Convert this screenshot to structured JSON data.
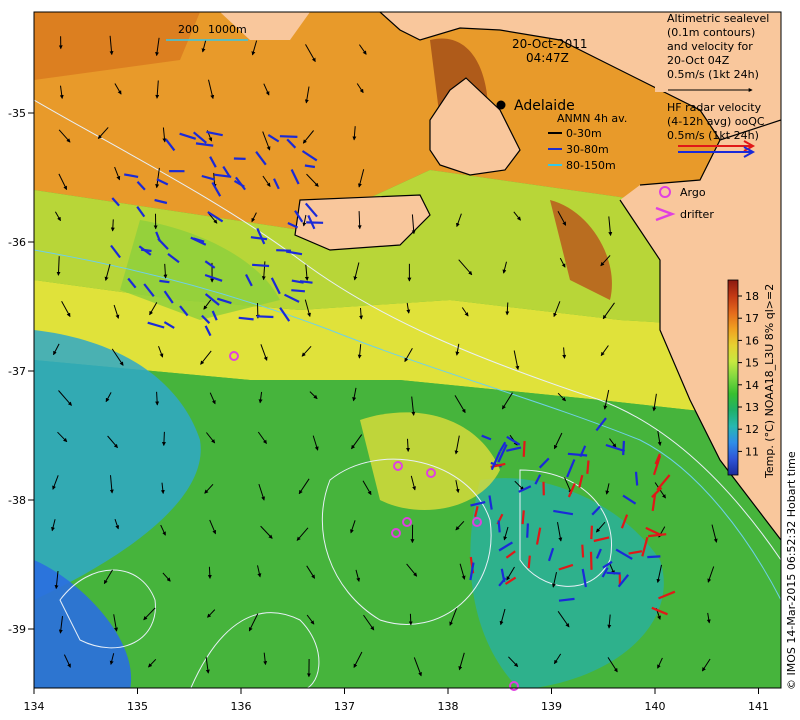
{
  "map": {
    "date": "20-Oct-2011",
    "time": "04:47Z",
    "city": "Adelaide",
    "scale_label": "200",
    "depth_label": "1000m",
    "x_ticks": [
      "134",
      "135",
      "136",
      "137",
      "138",
      "139",
      "140",
      "141"
    ],
    "y_ticks": [
      "-35",
      "-36",
      "-37",
      "-38",
      "-39"
    ],
    "credit": "© IMOS 14-Mar-2015 06:52:32 Hobart time"
  },
  "legend": {
    "altimetry": [
      "Altimetric sealevel",
      "(0.1m contours)",
      "and velocity for",
      "20-Oct 04Z",
      "0.5m/s (1kt 24h)"
    ],
    "hf_radar": [
      "HF radar velocity",
      "(4-12h avg) ooQC",
      "0.5m/s (1kt 24h)"
    ],
    "anmn_title": "ANMN 4h av.",
    "anmn_items": [
      {
        "label": "0-30m",
        "color": "#000000"
      },
      {
        "label": "30-80m",
        "color": "#1f2ecc"
      },
      {
        "label": "80-150m",
        "color": "#35c8e8"
      }
    ],
    "argo": "Argo",
    "drifter": "drifter"
  },
  "colorbar": {
    "label": "Temp. (°C) NOAA18_L3U 8% ql>=2",
    "ticks": [
      "18",
      "17",
      "16",
      "15",
      "14",
      "13",
      "12",
      "11"
    ],
    "colors": [
      "#8c1a10",
      "#c43a14",
      "#e46a1c",
      "#f0a020",
      "#e8d030",
      "#c8e840",
      "#80d840",
      "#38c030",
      "#20b068",
      "#28b8b0",
      "#2f8ee8",
      "#2f55d8",
      "#1a2a9a"
    ]
  },
  "colors": {
    "land": "#f9c79c",
    "coast": "#000000",
    "contour": "#e8f0f8",
    "hf_red": "#e01818",
    "hf_blue": "#1a2ad8",
    "argo": "#e040e0"
  }
}
